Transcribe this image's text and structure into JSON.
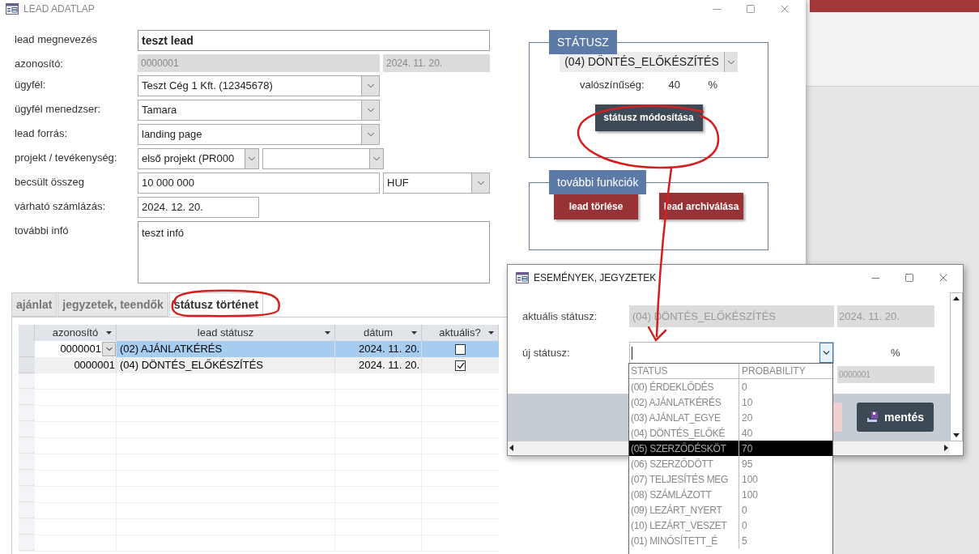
{
  "main_window": {
    "title": "LEAD ADATLAP"
  },
  "form": [
    {
      "label": "lead megnevezés",
      "fields": [
        {
          "kind": "title",
          "value": "teszt lead"
        }
      ]
    },
    {
      "label": "azonosító:",
      "fields": [
        {
          "kind": "readonly",
          "value": "0000001"
        },
        {
          "kind": "readonly",
          "value": "2024. 11. 20."
        }
      ]
    },
    {
      "label": "ügyfél:",
      "fields": [
        {
          "kind": "combo",
          "value": "Teszt Cég 1 Kft. (12345678)"
        }
      ]
    },
    {
      "label": "ügyfél menedzser:",
      "fields": [
        {
          "kind": "combo",
          "value": "Tamara"
        }
      ]
    },
    {
      "label": "lead forrás:",
      "fields": [
        {
          "kind": "combo",
          "value": "landing page"
        }
      ]
    },
    {
      "label": "projekt / tevékenység:",
      "fields": [
        {
          "kind": "combo",
          "value": "első projekt (PR000"
        },
        {
          "kind": "combo"
        }
      ]
    },
    {
      "label": "becsült összeg",
      "fields": [
        {
          "kind": "text",
          "value": "10 000 000"
        },
        {
          "kind": "combo",
          "value": "HUF"
        }
      ]
    },
    {
      "label": "várható számlázás:",
      "fields": [
        {
          "kind": "date",
          "value": "2024. 12. 20."
        }
      ]
    },
    {
      "label": "további infó",
      "fields": [
        {
          "kind": "textarea",
          "value": "teszt infó"
        }
      ]
    }
  ],
  "status_panel": {
    "title": "STÁTUSZ",
    "status": "(04) DÖNTÉS_ELŐKÉSZÍTÉS",
    "probability_label": "valószínűség:",
    "probability": "40",
    "unit": "%",
    "button": "státusz módosítása"
  },
  "functions_panel": {
    "title": "további funkciók",
    "buttons": [
      "lead törlése",
      "lead archiválása"
    ]
  },
  "tabs": [
    {
      "label": "ajánlat",
      "selected": false
    },
    {
      "label": "jegyzetek, teendők",
      "selected": false
    },
    {
      "label": "státusz történet",
      "selected": true
    }
  ],
  "table": {
    "columns": [
      "azonosító",
      "lead státusz",
      "dátum",
      "aktuális?"
    ],
    "rows": [
      {
        "id": "0000001",
        "status": "(02) AJÁNLATKÉRÉS",
        "date": "2024. 11. 20.",
        "current": false,
        "selected": true
      },
      {
        "id": "0000001",
        "status": "(04) DÖNTÉS_ELŐKÉSZÍTÉS",
        "date": "2024. 11. 20.",
        "current": true,
        "selected": false
      }
    ]
  },
  "dialog": {
    "title": "ESEMÉNYEK, JEGYZETEK",
    "current_label": "aktuális státusz:",
    "current_status": "(04) DÖNTÉS_ELŐKÉSZÍTÉS",
    "current_date": "2024. 11. 20.",
    "new_label": "új státusz:",
    "unit": "%",
    "id": "0000001",
    "save_button": "mentés",
    "dropdown": {
      "columns": [
        "STATUS",
        "PROBABILITY"
      ],
      "items": [
        {
          "status": "(00) ÉRDEKLŐDÉS",
          "probability": "0",
          "selected": false
        },
        {
          "status": "(02) AJÁNLATKÉRÉS",
          "probability": "10",
          "selected": false
        },
        {
          "status": "(03) AJÁNLAT_EGYE",
          "probability": "20",
          "selected": false
        },
        {
          "status": "(04) DÖNTÉS_ELŐKÉ",
          "probability": "40",
          "selected": false
        },
        {
          "status": "(05) SZERZŐDÉSKÖT",
          "probability": "70",
          "selected": true
        },
        {
          "status": "(06) SZERZŐDÖTT",
          "probability": "95",
          "selected": false
        },
        {
          "status": "(07) TELJESÍTÉS MEG",
          "probability": "100",
          "selected": false
        },
        {
          "status": "(08) SZÁMLÁZOTT",
          "probability": "100",
          "selected": false
        },
        {
          "status": "(09) LEZÁRT_NYERT",
          "probability": "0",
          "selected": false
        },
        {
          "status": "(10) LEZÁRT_VESZET",
          "probability": "0",
          "selected": false
        },
        {
          "status": "(01) MINŐSÍTETT_É",
          "probability": "5",
          "selected": false
        }
      ]
    }
  }
}
